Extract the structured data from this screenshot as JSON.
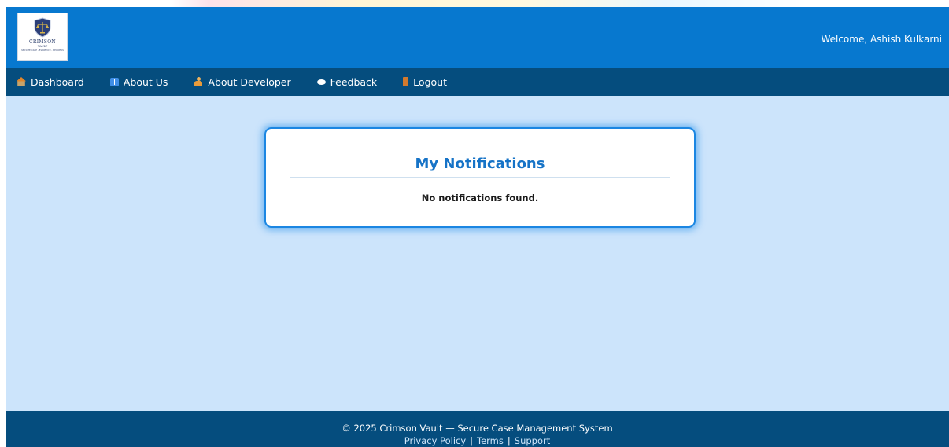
{
  "header": {
    "logo": {
      "title": "CRIMSON",
      "subtitle": "VAULT",
      "tagline": "SECURE CASE - EVIDENCE - RECORDS"
    },
    "welcome": "Welcome, Ashish Kulkarni"
  },
  "nav": {
    "items": [
      {
        "label": "Dashboard",
        "icon": "house-icon"
      },
      {
        "label": "About Us",
        "icon": "info-icon"
      },
      {
        "label": "About Developer",
        "icon": "developer-icon"
      },
      {
        "label": "Feedback",
        "icon": "speech-bubble-icon"
      },
      {
        "label": "Logout",
        "icon": "door-icon"
      }
    ]
  },
  "main": {
    "title": "My Notifications",
    "message": "No notifications found."
  },
  "footer": {
    "copyright": "© 2025 Crimson Vault — Secure Case Management System",
    "links": [
      "Privacy Policy",
      "Terms",
      "Support"
    ],
    "separator": "|"
  },
  "colors": {
    "header_bg": "#0778cf",
    "nav_bg": "#054d7e",
    "page_bg": "#cce4fb",
    "title_blue": "#1673c7",
    "card_border": "#1b86e2"
  }
}
